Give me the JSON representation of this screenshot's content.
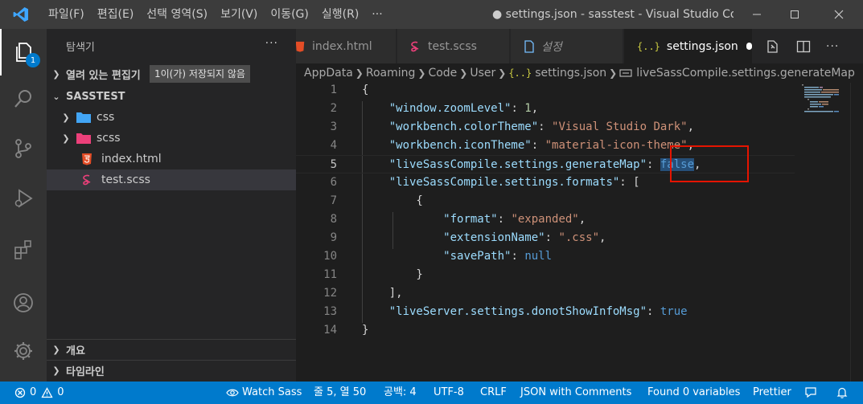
{
  "titlebar": {
    "menu": [
      "파일(F)",
      "편집(E)",
      "선택 영역(S)",
      "보기(V)",
      "이동(G)",
      "실행(R)",
      "···"
    ],
    "title": "● settings.json - sasstest - Visual Studio Cod..."
  },
  "activity": {
    "explorer_badge": "1"
  },
  "sidebar": {
    "title": "탐색기",
    "more": "···",
    "open_editors": "열려 있는 편집기",
    "unsaved": "1이(가) 저장되지 않음",
    "project": "SASSTEST",
    "tree": [
      {
        "label": "css",
        "type": "folder"
      },
      {
        "label": "scss",
        "type": "folder"
      },
      {
        "label": "index.html",
        "type": "html"
      },
      {
        "label": "test.scss",
        "type": "scss"
      }
    ],
    "outline": "개요",
    "timeline": "타임라인"
  },
  "tabs": [
    {
      "label": "index.html",
      "icon": "html-icon"
    },
    {
      "label": "test.scss",
      "icon": "sass-icon"
    },
    {
      "label": "설정",
      "icon": "file-icon"
    },
    {
      "label": "settings.json",
      "icon": "json-icon",
      "active": true,
      "modified": true
    }
  ],
  "breadcrumb": [
    "AppData",
    "Roaming",
    "Code",
    "User",
    "settings.json",
    "liveSassCompile.settings.generateMap"
  ],
  "editor": {
    "line_numbers": [
      "1",
      "2",
      "3",
      "4",
      "5",
      "6",
      "7",
      "8",
      "9",
      "10",
      "11",
      "12",
      "13",
      "14"
    ],
    "lines": [
      [
        [
          "{",
          "p"
        ]
      ],
      [
        [
          "    ",
          "p"
        ],
        [
          "\"window.zoomLevel\"",
          "k"
        ],
        [
          ": ",
          "p"
        ],
        [
          "1",
          "n"
        ],
        [
          ",",
          "p"
        ]
      ],
      [
        [
          "    ",
          "p"
        ],
        [
          "\"workbench.colorTheme\"",
          "k"
        ],
        [
          ": ",
          "p"
        ],
        [
          "\"Visual Studio Dark\"",
          "s"
        ],
        [
          ",",
          "p"
        ]
      ],
      [
        [
          "    ",
          "p"
        ],
        [
          "\"workbench.iconTheme\"",
          "k"
        ],
        [
          ": ",
          "p"
        ],
        [
          "\"material-icon-theme\"",
          "s"
        ],
        [
          ",",
          "p"
        ]
      ],
      [
        [
          "    ",
          "p"
        ],
        [
          "\"liveSassCompile.settings.generateMap\"",
          "k"
        ],
        [
          ": ",
          "p"
        ],
        [
          "false",
          "b sel-word"
        ],
        [
          ",",
          "p"
        ]
      ],
      [
        [
          "    ",
          "p"
        ],
        [
          "\"liveSassCompile.settings.formats\"",
          "k"
        ],
        [
          ": [",
          "p"
        ]
      ],
      [
        [
          "        {",
          "p"
        ]
      ],
      [
        [
          "            ",
          "p"
        ],
        [
          "\"format\"",
          "k"
        ],
        [
          ": ",
          "p"
        ],
        [
          "\"expanded\"",
          "s"
        ],
        [
          ",",
          "p"
        ]
      ],
      [
        [
          "            ",
          "p"
        ],
        [
          "\"extensionName\"",
          "k"
        ],
        [
          ": ",
          "p"
        ],
        [
          "\".css\"",
          "s"
        ],
        [
          ",",
          "p"
        ]
      ],
      [
        [
          "            ",
          "p"
        ],
        [
          "\"savePath\"",
          "k"
        ],
        [
          ": ",
          "p"
        ],
        [
          "null",
          "b"
        ]
      ],
      [
        [
          "        }",
          "p"
        ]
      ],
      [
        [
          "    ],",
          "p"
        ]
      ],
      [
        [
          "    ",
          "p"
        ],
        [
          "\"liveServer.settings.donotShowInfoMsg\"",
          "k"
        ],
        [
          ": ",
          "p"
        ],
        [
          "true",
          "b"
        ]
      ],
      [
        [
          "}",
          "p"
        ]
      ]
    ],
    "current_line": 5
  },
  "statusbar": {
    "errors": "0",
    "warnings": "0",
    "watch_sass": "Watch Sass",
    "position": "줄 5, 열 50",
    "spaces": "공백: 4",
    "encoding": "UTF-8",
    "eol": "CRLF",
    "language": "JSON with Comments",
    "variables": "Found 0 variables",
    "formatter": "Prettier"
  },
  "colors": {
    "accent": "#007acc",
    "highlight_box": "#e51400"
  }
}
